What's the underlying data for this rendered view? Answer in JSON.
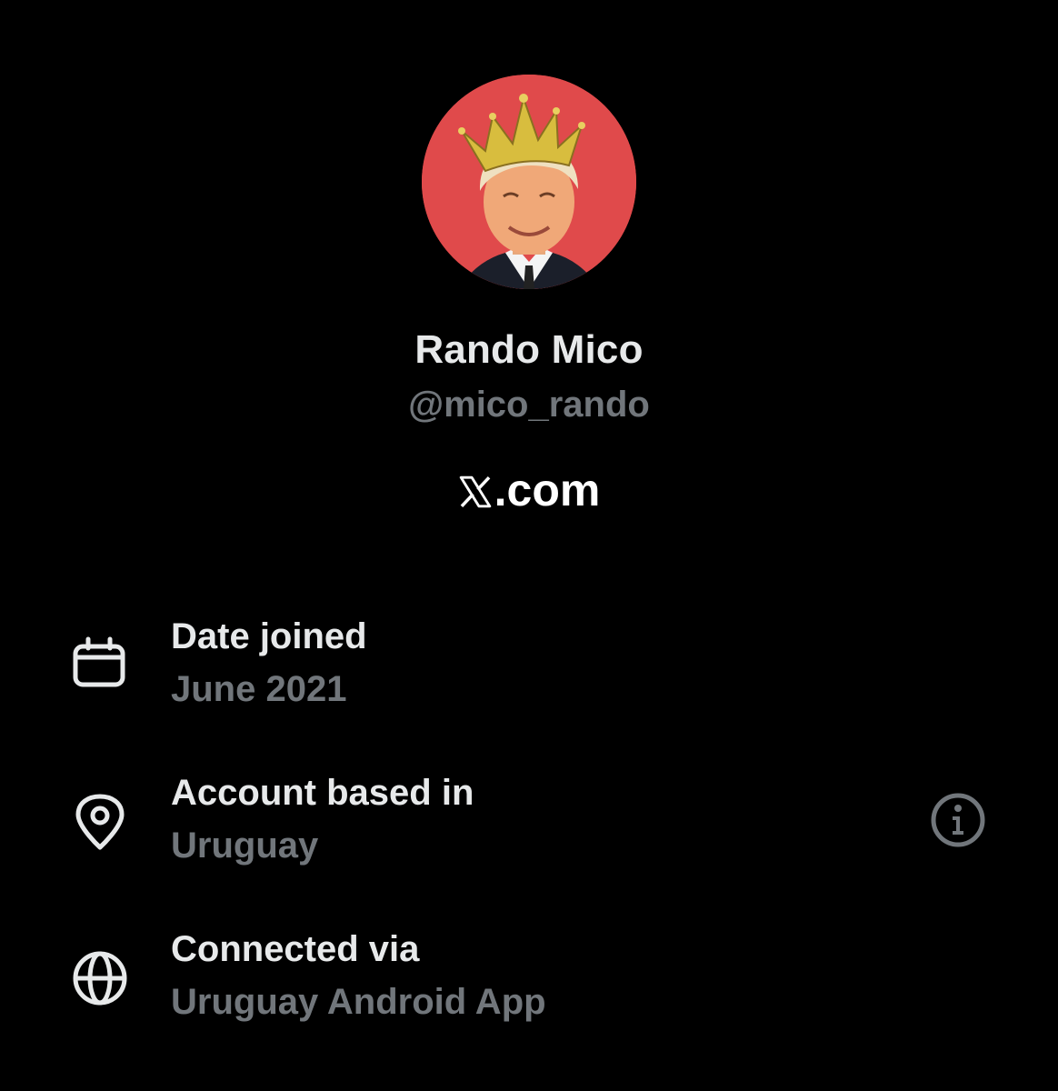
{
  "profile": {
    "display_name": "Rando Mico",
    "handle": "@mico_rando",
    "avatar_background": "#e04a4b"
  },
  "brand": {
    "icon": "x-logo-icon",
    "suffix": ".com"
  },
  "about": {
    "items": [
      {
        "icon": "calendar-icon",
        "label": "Date joined",
        "value": "June 2021"
      },
      {
        "icon": "location-pin-icon",
        "label": "Account based in",
        "value": "Uruguay",
        "action_icon": "info-icon"
      },
      {
        "icon": "globe-icon",
        "label": "Connected via",
        "value": "Uruguay Android App"
      }
    ]
  },
  "colors": {
    "background": "#000000",
    "primary_text": "#e7e9ea",
    "secondary_text": "#71767b"
  }
}
